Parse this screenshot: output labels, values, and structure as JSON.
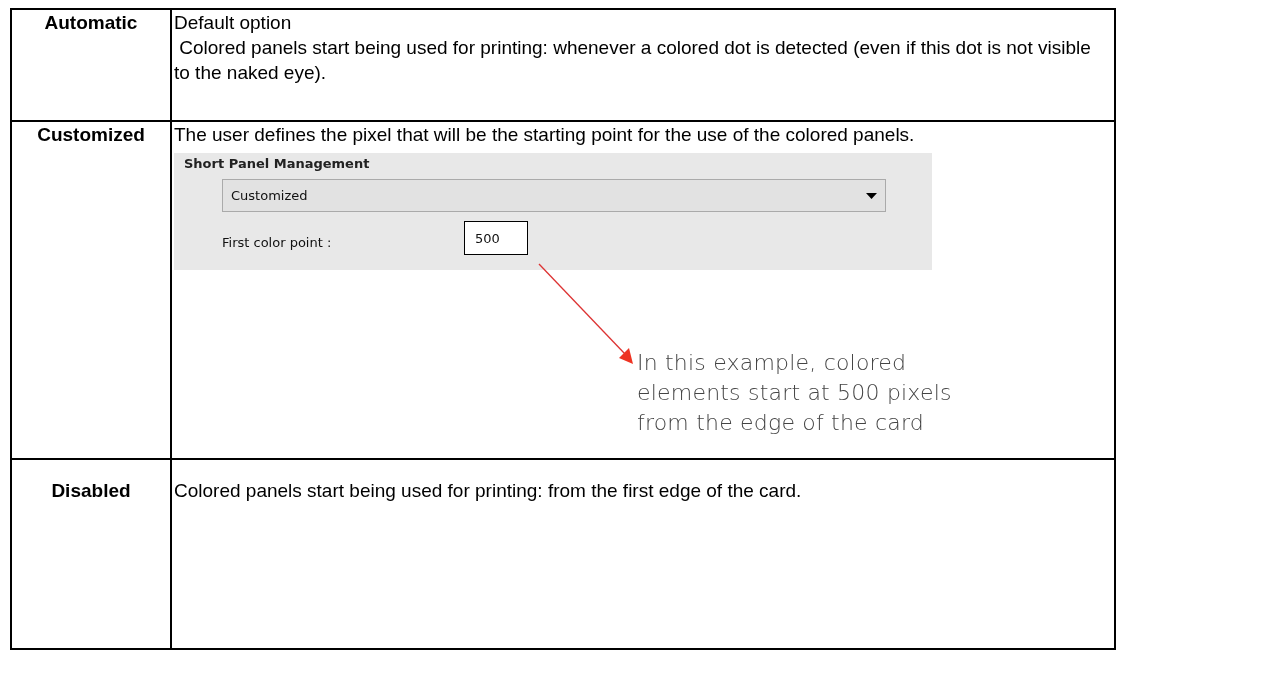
{
  "table": {
    "rows": [
      {
        "term": "Automatic",
        "lines": [
          "Default option",
          " Colored panels start being used for printing: whenever a colored dot is detected (even if this dot is not visible to the naked eye)."
        ]
      },
      {
        "term": "Customized",
        "lines": [
          "The user defines the pixel that will be the starting point for the use of the colored panels."
        ],
        "screenshot": {
          "title": "Short Panel Management",
          "dropdown_value": "Customized",
          "field_label": "First color point :",
          "field_value": "500"
        },
        "annotation": "In this example, colored elements start at 500 pixels from the edge of the card"
      },
      {
        "term": "Disabled",
        "lines": [
          "Colored panels start being used for printing: from the first edge of the card."
        ]
      }
    ]
  }
}
